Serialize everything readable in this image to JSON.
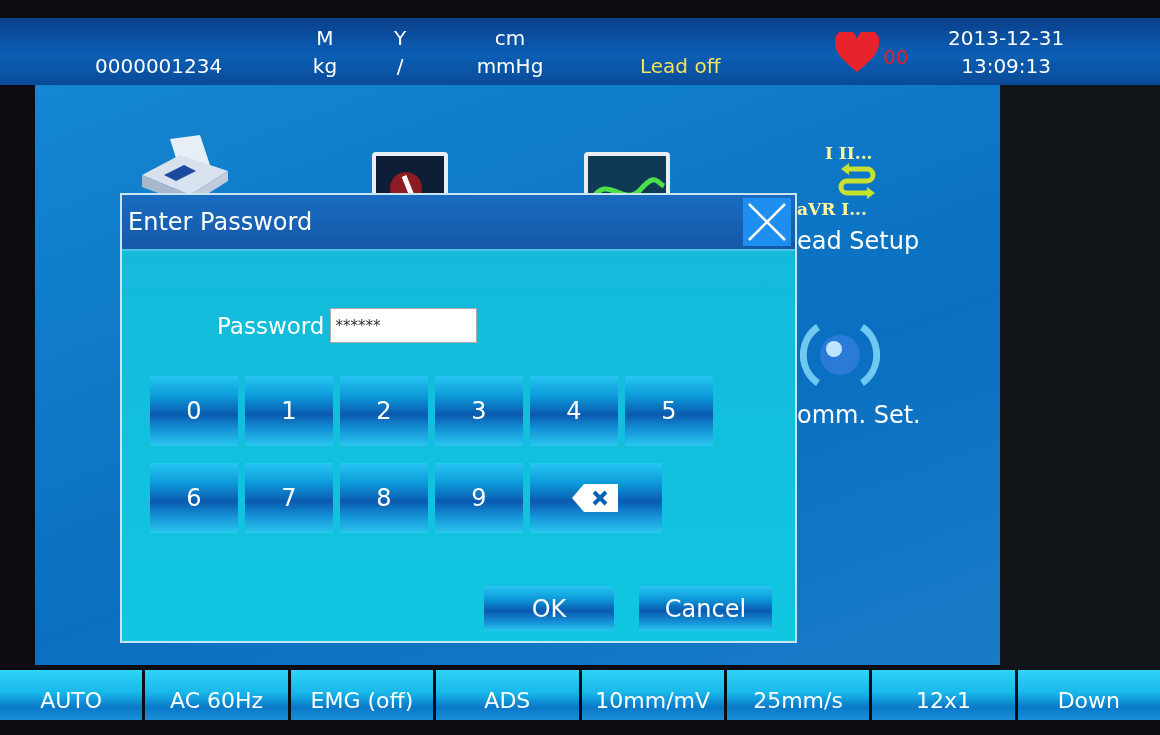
{
  "header": {
    "patient_id": "0000001234",
    "gender_label": "M",
    "weight_unit": "kg",
    "age_label": "Y",
    "separator": "/",
    "height_unit": "cm",
    "pressure_unit": "mmHg",
    "lead_status": "Lead off",
    "heart_rate": "00",
    "date": "2013-12-31",
    "time": "13:09:13"
  },
  "background_menu": {
    "lead_setup": {
      "lead_names_top": "I II...",
      "lead_names_bottom": "aVR I...",
      "label": "ead Setup"
    },
    "comm_settings": {
      "label": "omm. Set."
    }
  },
  "dialog": {
    "title": "Enter Password",
    "password_label": "Password",
    "password_value": "******",
    "keys": [
      {
        "kind": "digit",
        "label": "0"
      },
      {
        "kind": "digit",
        "label": "1"
      },
      {
        "kind": "digit",
        "label": "2"
      },
      {
        "kind": "digit",
        "label": "3"
      },
      {
        "kind": "digit",
        "label": "4"
      },
      {
        "kind": "digit",
        "label": "5"
      },
      {
        "kind": "digit",
        "label": "6"
      },
      {
        "kind": "digit",
        "label": "7"
      },
      {
        "kind": "digit",
        "label": "8"
      },
      {
        "kind": "digit",
        "label": "9"
      },
      {
        "kind": "backspace"
      }
    ],
    "buttons": [
      "OK",
      "Cancel"
    ]
  },
  "status_bar": [
    "AUTO",
    "AC 60Hz",
    "EMG (off)",
    "ADS",
    "10mm/mV",
    "25mm/s",
    "12x1",
    "Down"
  ]
}
